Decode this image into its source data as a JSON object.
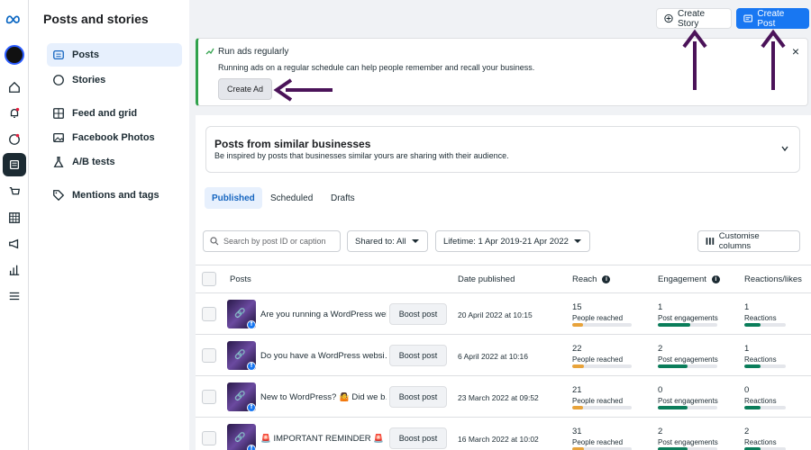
{
  "app": {
    "brand": "Meta",
    "page_title": "Posts and stories"
  },
  "rail_icons": [
    "meta-logo-icon",
    "avatar",
    "home-icon",
    "bell-icon",
    "chat-icon",
    "posts-icon",
    "shop-icon",
    "grid-icon",
    "megaphone-icon",
    "chart-icon",
    "menu-icon"
  ],
  "sidebar": {
    "items": [
      {
        "label": "Posts",
        "icon": "posts-icon",
        "active": true
      },
      {
        "label": "Stories",
        "icon": "stories-icon",
        "active": false
      },
      {
        "label": "Feed and grid",
        "icon": "feed-grid-icon",
        "active": false
      },
      {
        "label": "Facebook Photos",
        "icon": "photos-icon",
        "active": false
      },
      {
        "label": "A/B tests",
        "icon": "flask-icon",
        "active": false
      },
      {
        "label": "Mentions and tags",
        "icon": "tag-icon",
        "active": false
      }
    ]
  },
  "header": {
    "create_story": "Create Story",
    "create_post": "Create Post"
  },
  "banner": {
    "title": "Run ads regularly",
    "text": "Running ads on a regular schedule can help people remember and recall your business.",
    "button": "Create Ad",
    "close": "×"
  },
  "similar": {
    "title": "Posts from similar businesses",
    "subtitle": "Be inspired by posts that businesses similar yours are sharing with their audience."
  },
  "tabs": [
    {
      "label": "Published",
      "active": true
    },
    {
      "label": "Scheduled",
      "active": false
    },
    {
      "label": "Drafts",
      "active": false
    }
  ],
  "filters": {
    "search_placeholder": "Search by post ID or caption",
    "shared_to": "Shared to: All",
    "lifetime": "Lifetime: 1 Apr 2019-21 Apr 2022",
    "customise": "Customise columns"
  },
  "table": {
    "columns": {
      "posts": "Posts",
      "date": "Date published",
      "reach": "Reach",
      "engagement": "Engagement",
      "reactions": "Reactions/likes"
    },
    "boost_label": "Boost post",
    "reach_label": "People reached",
    "engagement_label": "Post engagements",
    "reactions_label": "Reactions",
    "rows": [
      {
        "title": "Are you running a WordPress web…",
        "date": "20 April 2022 at 10:15",
        "reach": "15",
        "engagement": "1",
        "reactions": "1",
        "reach_pct": 0.18,
        "eng_pct": 0.55,
        "react_pct": 0.4
      },
      {
        "title": "Do you have a WordPress websi…",
        "date": "6 April 2022 at 10:16",
        "reach": "22",
        "engagement": "2",
        "reactions": "1",
        "reach_pct": 0.2,
        "eng_pct": 0.5,
        "react_pct": 0.4
      },
      {
        "title": "New to WordPress? 🤷 Did we b…",
        "date": "23 March 2022 at 09:52",
        "reach": "21",
        "engagement": "0",
        "reactions": "0",
        "reach_pct": 0.18,
        "eng_pct": 0.5,
        "react_pct": 0.4
      },
      {
        "title": "🚨 IMPORTANT REMINDER 🚨 S…",
        "date": "16 March 2022 at 10:02",
        "reach": "31",
        "engagement": "2",
        "reactions": "2",
        "reach_pct": 0.2,
        "eng_pct": 0.5,
        "react_pct": 0.4
      }
    ]
  },
  "colors": {
    "accent": "#1877f2",
    "reach_bar": "#e8a33a",
    "eng_bar": "#0a7d5a",
    "arrow": "#4b1359"
  }
}
